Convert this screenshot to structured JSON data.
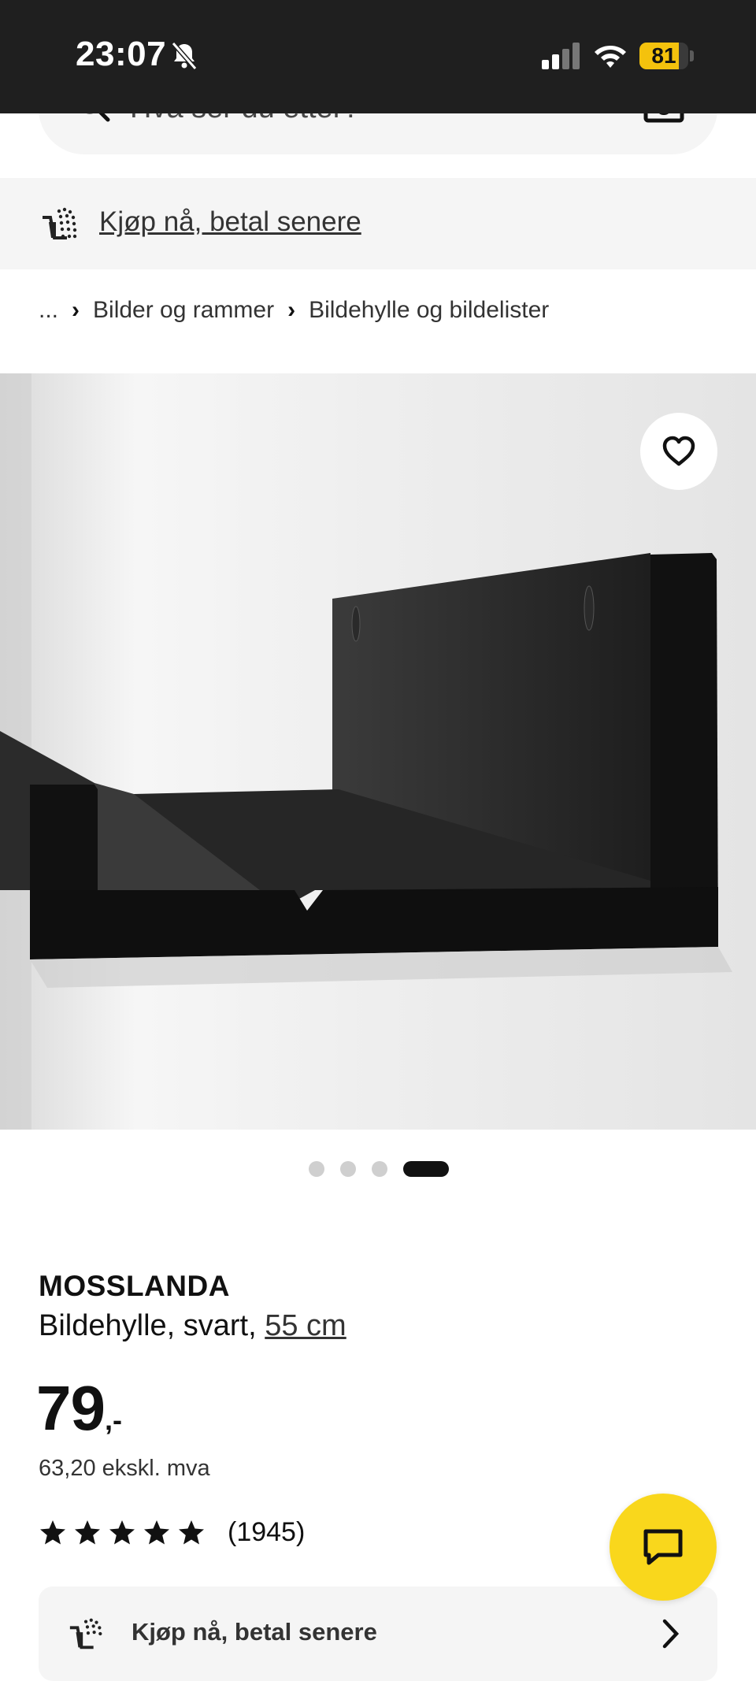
{
  "status_bar": {
    "time": "23:07",
    "battery": "81",
    "battery_level": 0.81
  },
  "search": {
    "placeholder": "Hva ser du etter?"
  },
  "promo_banner": {
    "label": "Kjøp nå, betal senere"
  },
  "breadcrumb": {
    "ellipsis": "...",
    "items": [
      "Bilder og rammer",
      "Bildehylle og bildelister"
    ]
  },
  "carousel": {
    "count": 4,
    "active_index": 3
  },
  "product": {
    "name": "MOSSLANDA",
    "description": "Bildehylle, svart,",
    "size": "55 cm",
    "price": "79",
    "price_suffix": ",-",
    "price_ex_vat": "63,20 ekskl. mva",
    "rating": 5,
    "review_count": "(1945)"
  },
  "bnpl_card": {
    "label": "Kjøp nå, betal senere"
  },
  "colors": {
    "accent_yellow": "#f9d71c",
    "status_bar_bg": "#1f1f1f",
    "panel_bg": "#f5f5f5"
  },
  "icons": [
    "bell-slash-icon",
    "signal-icon",
    "wifi-icon",
    "battery-icon",
    "search-icon",
    "camera-icon",
    "cart-icon",
    "chevron-right-icon",
    "heart-icon",
    "star-icon",
    "chat-icon"
  ]
}
